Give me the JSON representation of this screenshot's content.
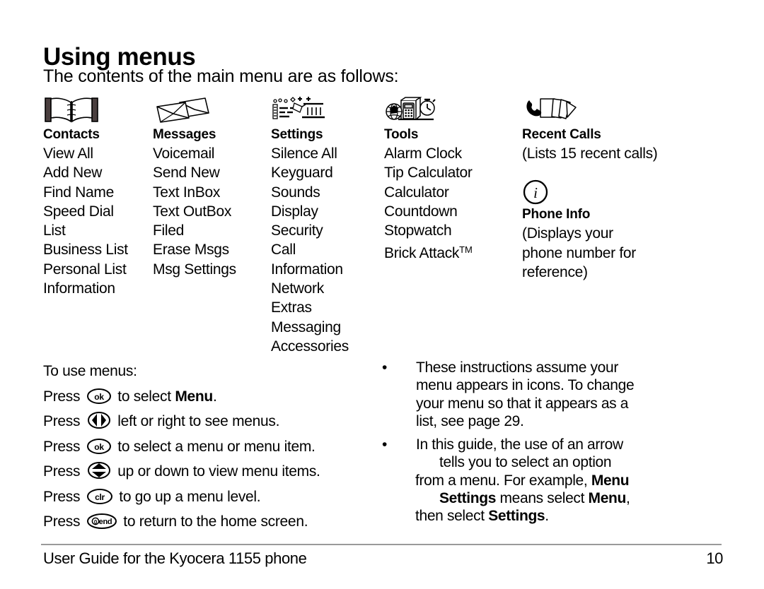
{
  "document": {
    "title": "Using menus",
    "subtitle": "The contents of the main menu are as follows:"
  },
  "menu_columns": [
    {
      "icon": "open-book-icon",
      "heading": "Contacts",
      "items": [
        "View All",
        "Add New",
        "Find Name",
        "Speed Dial",
        "List",
        "Business List",
        "Personal List",
        "Information"
      ]
    },
    {
      "icon": "envelopes-icon",
      "heading": "Messages",
      "items": [
        "Voicemail",
        "Send New",
        "Text InBox",
        "Text OutBox",
        "Filed",
        "Erase Msgs",
        "Msg Settings"
      ]
    },
    {
      "icon": "settings-sliders-icon",
      "heading": "Settings",
      "items": [
        "Silence All",
        "Keyguard",
        "Sounds",
        "Display",
        "Security",
        "Call",
        "Information",
        "Network",
        "Extras",
        "Messaging",
        "Accessories"
      ]
    },
    {
      "icon": "tools-calculator-globe-icon",
      "heading": "Tools",
      "items": [
        "Alarm Clock",
        "Tip Calculator",
        "Calculator",
        "Countdown",
        "Stopwatch"
      ],
      "trademark_item": {
        "text": "Brick Attack",
        "mark": "TM"
      }
    },
    {
      "icon": "phone-cards-icon",
      "heading": "Recent Calls",
      "note": "(Lists 15 recent calls)",
      "secondary": {
        "icon": "info-circle-icon",
        "heading": "Phone Info",
        "note_lines": [
          "(Displays your",
          "phone number for",
          "reference)"
        ]
      }
    }
  ],
  "instructions": {
    "intro": "To use menus:",
    "lines": [
      {
        "press": "Press",
        "key": "ok-key",
        "key_label": "ok",
        "before": "to select ",
        "bold": "Menu",
        "after": "."
      },
      {
        "press": "Press",
        "key": "left-right-key",
        "key_label": "",
        "before": "left or right to see menus.",
        "bold": "",
        "after": ""
      },
      {
        "press": "Press",
        "key": "ok-key",
        "key_label": "ok",
        "before": "to select a menu or menu item.",
        "bold": "",
        "after": ""
      },
      {
        "press": "Press",
        "key": "up-down-key",
        "key_label": "",
        "before": "up or down to view menu items.",
        "bold": "",
        "after": ""
      },
      {
        "press": "Press",
        "key": "clr-key",
        "key_label": "clr",
        "before": "to go up a menu level.",
        "bold": "",
        "after": ""
      },
      {
        "press": "Press",
        "key": "end-key",
        "key_label": "end",
        "before": "to return to the home screen.",
        "bold": "",
        "after": ""
      }
    ]
  },
  "bullets": [
    {
      "marker": "•",
      "lines": [
        "These instructions assume your",
        "menu appears in icons. To change",
        "your menu so that it appears as a",
        "list, see page 29."
      ]
    },
    {
      "marker": "•",
      "line1": "In this guide, the use of an arrow",
      "line2": "tells you to select an option",
      "line3_a": "from a menu. For example, ",
      "line3_b": "Menu",
      "line4_a": "Settings",
      "line4_b": " means select ",
      "line4_c": "Menu",
      "line4_d": ",",
      "line5_a": "then select ",
      "line5_b": "Settings",
      "line5_c": "."
    }
  ],
  "footer": {
    "left": "User Guide for the Kyocera 1155 phone",
    "page_number": "10"
  }
}
